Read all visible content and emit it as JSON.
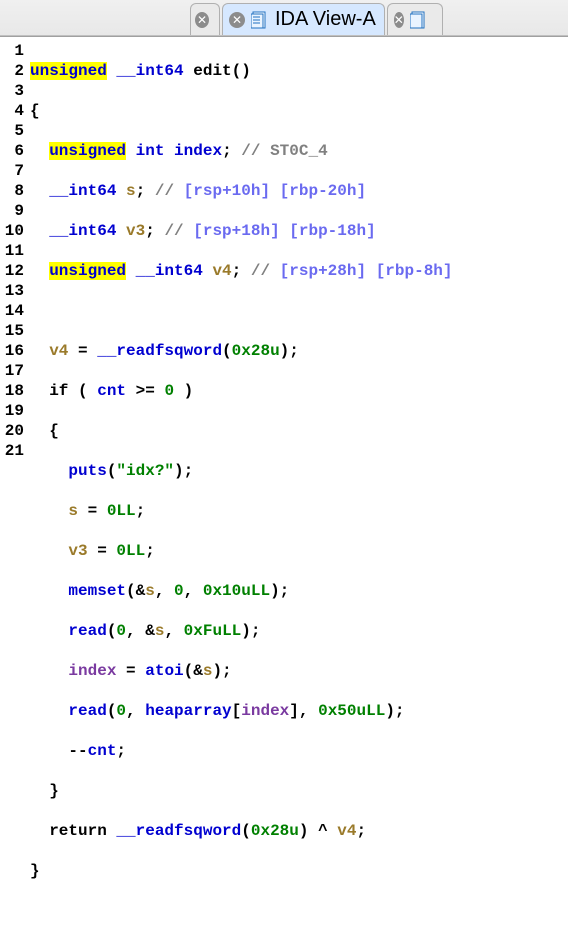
{
  "tabs": {
    "active_label": "IDA View-A"
  },
  "code": {
    "l1": {
      "a": "unsigned",
      "b": " ",
      "c": "__int64",
      "d": " edit()"
    },
    "l2": "{",
    "l3": {
      "a": "  ",
      "b": "unsigned",
      "c": " ",
      "d": "int",
      "e": " ",
      "f": "index",
      "g": "; ",
      "h": "// ST0C_4"
    },
    "l4": {
      "a": "  ",
      "b": "__int64",
      "c": " ",
      "d": "s",
      "e": "; ",
      "f": "// ",
      "g": "[rsp+10h] [rbp-20h]"
    },
    "l5": {
      "a": "  ",
      "b": "__int64",
      "c": " ",
      "d": "v3",
      "e": "; ",
      "f": "// ",
      "g": "[rsp+18h] [rbp-18h]"
    },
    "l6": {
      "a": "  ",
      "b": "unsigned",
      "c": " ",
      "d": "__int64",
      "e": " ",
      "f": "v4",
      "g": "; ",
      "h": "// ",
      "i": "[rsp+28h] [rbp-8h]"
    },
    "l7": "",
    "l8": {
      "a": "  ",
      "b": "v4",
      "c": " = ",
      "d": "__readfsqword",
      "e": "(",
      "f": "0x28u",
      "g": ");"
    },
    "l9": {
      "a": "  if ( ",
      "b": "cnt",
      "c": " >= ",
      "d": "0",
      "e": " )"
    },
    "l10": "  {",
    "l11": {
      "a": "    ",
      "b": "puts",
      "c": "(",
      "d": "\"idx?\"",
      "e": ");"
    },
    "l12": {
      "a": "    ",
      "b": "s",
      "c": " = ",
      "d": "0LL",
      "e": ";"
    },
    "l13": {
      "a": "    ",
      "b": "v3",
      "c": " = ",
      "d": "0LL",
      "e": ";"
    },
    "l14": {
      "a": "    ",
      "b": "memset",
      "c": "(&",
      "d": "s",
      "e": ", ",
      "f": "0",
      "g": ", ",
      "h": "0x10uLL",
      "i": ");"
    },
    "l15": {
      "a": "    ",
      "b": "read",
      "c": "(",
      "d": "0",
      "e": ", &",
      "f": "s",
      "g": ", ",
      "h": "0xFuLL",
      "i": ");"
    },
    "l16": {
      "a": "    ",
      "b": "index",
      "c": " = ",
      "d": "atoi",
      "e": "(&",
      "f": "s",
      "g": ");"
    },
    "l17": {
      "a": "    ",
      "b": "read",
      "c": "(",
      "d": "0",
      "e": ", ",
      "f": "heaparray",
      "g": "[",
      "h": "index",
      "i": "], ",
      "j": "0x50uLL",
      "k": ");"
    },
    "l18": {
      "a": "    --",
      "b": "cnt",
      "c": ";"
    },
    "l19": "  }",
    "l20": {
      "a": "  return ",
      "b": "__readfsqword",
      "c": "(",
      "d": "0x28u",
      "e": ") ^ ",
      "f": "v4",
      "g": ";"
    },
    "l21": "}"
  },
  "line_count": 21
}
